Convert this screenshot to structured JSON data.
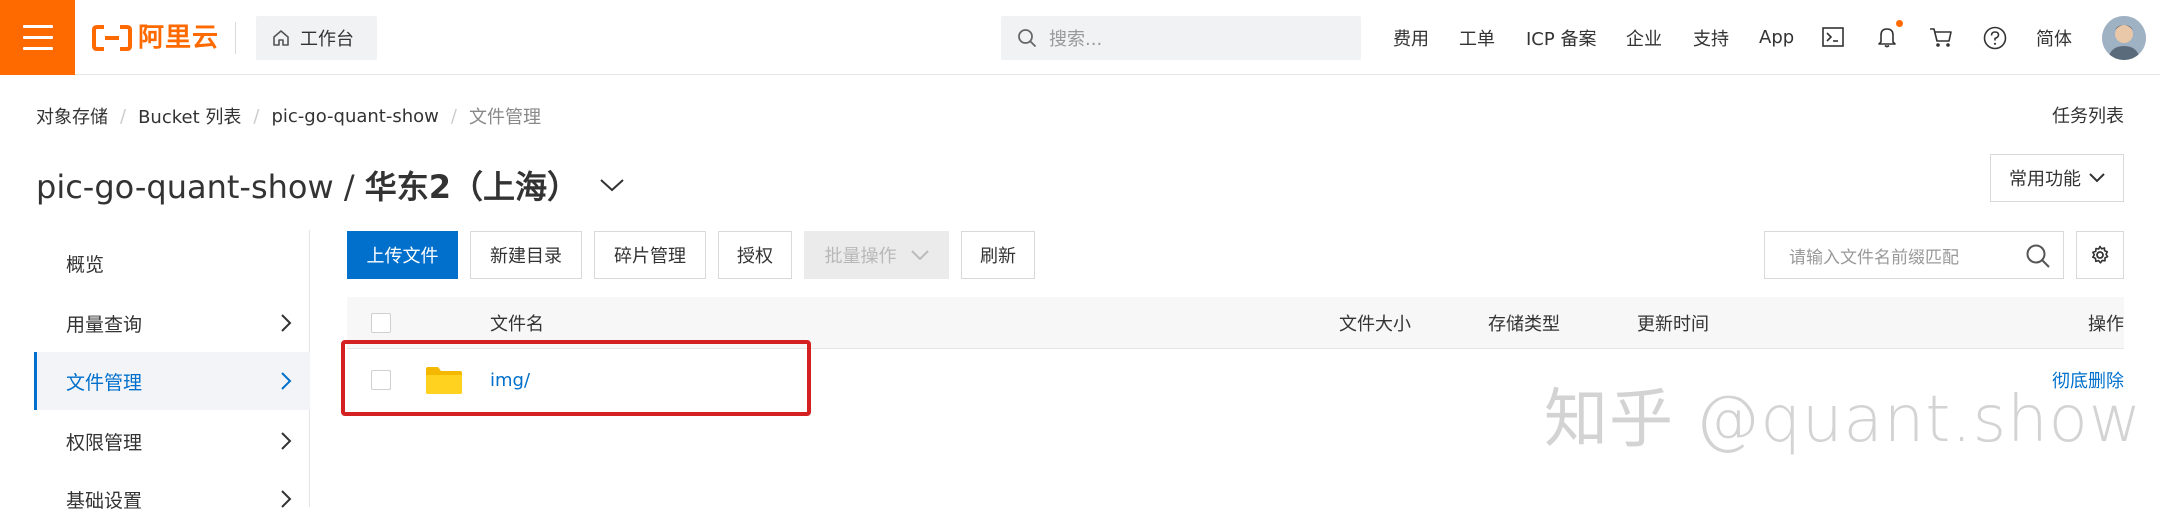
{
  "topbar": {
    "brand": "阿里云",
    "workbench": "工作台",
    "search_placeholder": "搜索...",
    "nav": [
      "费用",
      "工单",
      "ICP 备案",
      "企业",
      "支持",
      "App"
    ],
    "language": "简体",
    "accent_color": "#ff6a00",
    "icons": [
      "terminal-icon",
      "bell-icon",
      "cart-icon",
      "help-icon"
    ]
  },
  "breadcrumb": [
    "对象存储",
    "Bucket 列表",
    "pic-go-quant-show",
    "文件管理"
  ],
  "task_list": "任务列表",
  "title": {
    "bucket": "pic-go-quant-show",
    "separator": "/",
    "region": "华东2（上海）"
  },
  "common_functions": "常用功能",
  "sidebar": {
    "items": [
      {
        "label": "概览"
      },
      {
        "label": "用量查询"
      },
      {
        "label": "文件管理"
      },
      {
        "label": "权限管理"
      },
      {
        "label": "基础设置"
      }
    ],
    "active": "文件管理"
  },
  "toolbar": {
    "upload": "上传文件",
    "new_dir": "新建目录",
    "fragments": "碎片管理",
    "authorize": "授权",
    "batch": "批量操作",
    "refresh": "刷新",
    "filter_placeholder": "请输入文件名前缀匹配"
  },
  "table": {
    "columns": {
      "name": "文件名",
      "size": "文件大小",
      "storage": "存储类型",
      "updated": "更新时间",
      "action": "操作"
    },
    "rows": [
      {
        "name": "img/",
        "size": "",
        "storage": "",
        "updated": "",
        "action": "彻底删除"
      }
    ]
  },
  "watermark": "知乎 @quant.show"
}
